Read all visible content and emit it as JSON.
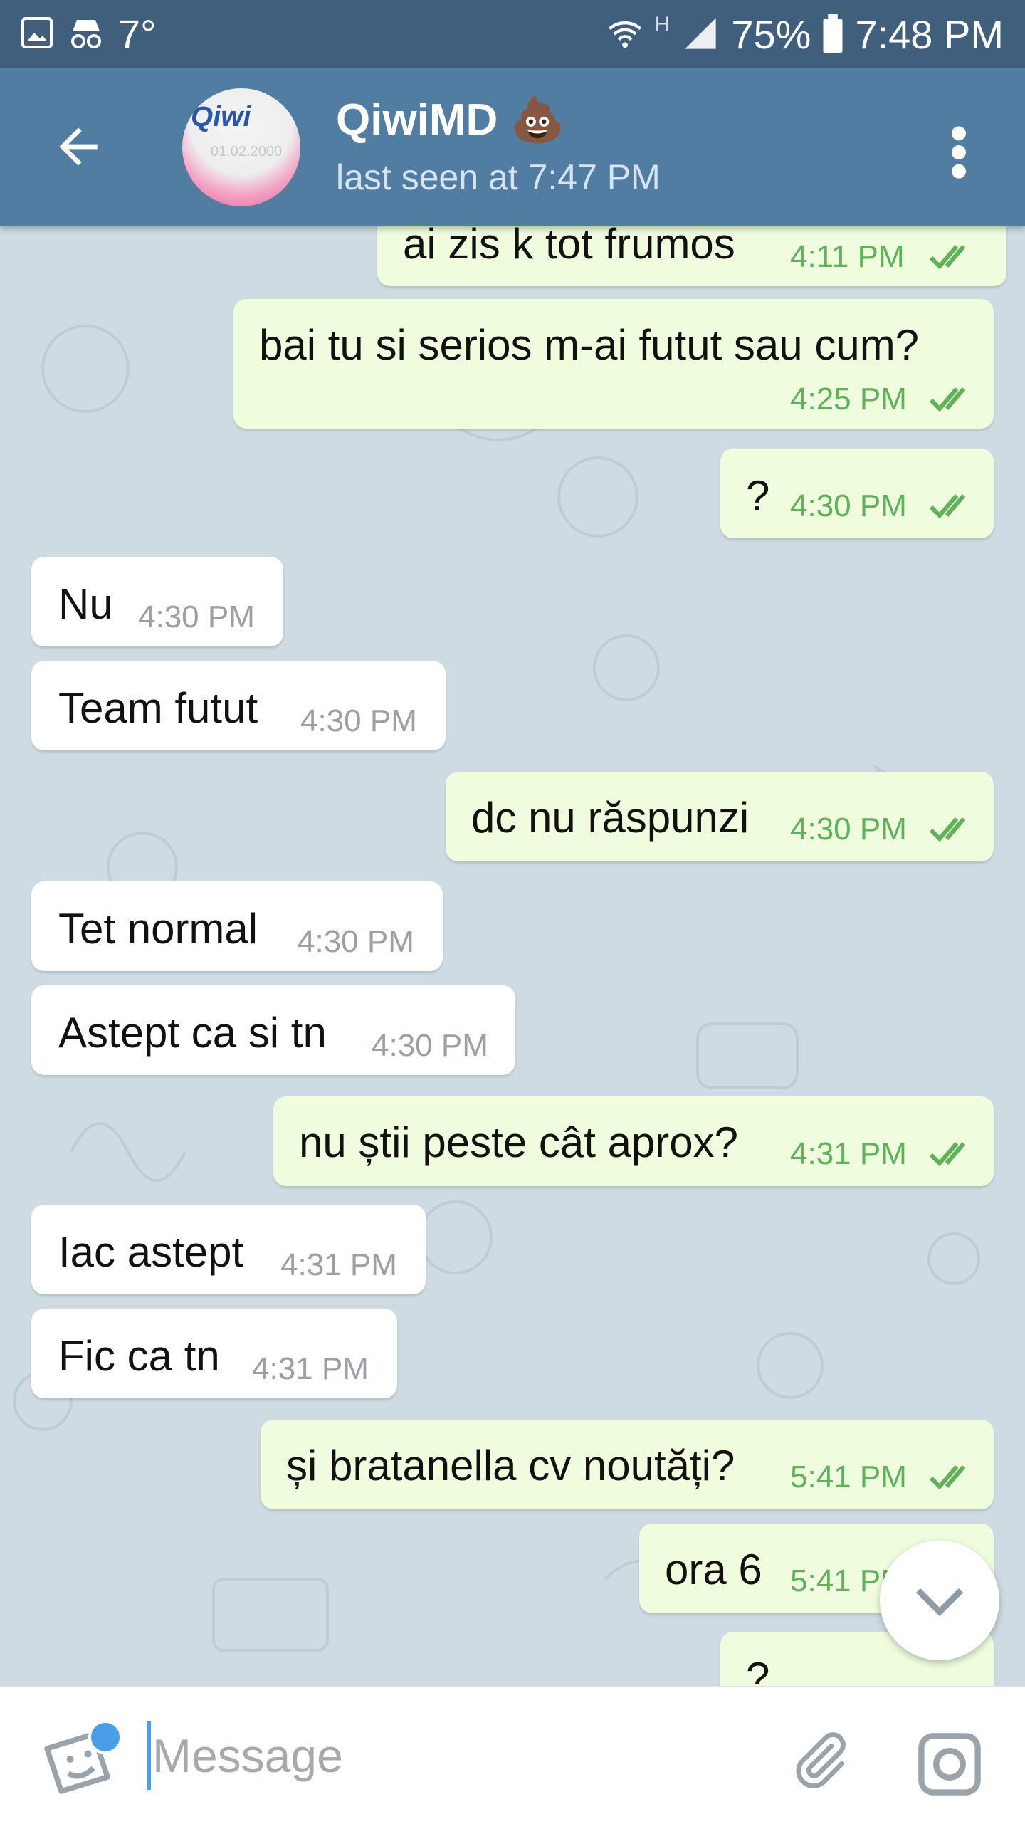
{
  "status_bar": {
    "temperature": "7°",
    "network_type": "H",
    "battery": "75%",
    "time": "7:48 PM"
  },
  "header": {
    "contact_name": "QiwiMD 💩",
    "last_seen": "last seen at 7:47 PM",
    "avatar_logo": "Qiwi",
    "avatar_date": "01.02.2000"
  },
  "messages": [
    {
      "dir": "out",
      "text": "ai zis k tot frumos",
      "time": "4:11 PM"
    },
    {
      "dir": "out",
      "text": "bai tu si serios m-ai futut sau cum?",
      "time": "4:25 PM"
    },
    {
      "dir": "out",
      "text": "?",
      "time": "4:30 PM"
    },
    {
      "dir": "in",
      "text": "Nu",
      "time": "4:30 PM"
    },
    {
      "dir": "in",
      "text": "Team futut",
      "time": "4:30 PM"
    },
    {
      "dir": "out",
      "text": "dc nu răspunzi",
      "time": "4:30 PM"
    },
    {
      "dir": "in",
      "text": "Tet normal",
      "time": "4:30 PM"
    },
    {
      "dir": "in",
      "text": "Astept ca si tn",
      "time": "4:30 PM"
    },
    {
      "dir": "out",
      "text": "nu știi peste cât aprox?",
      "time": "4:31 PM"
    },
    {
      "dir": "in",
      "text": "Iac astept",
      "time": "4:31 PM"
    },
    {
      "dir": "in",
      "text": "Fic ca tn",
      "time": "4:31 PM"
    },
    {
      "dir": "out",
      "text": "și bratanella cv noutăți?",
      "time": "5:41 PM"
    },
    {
      "dir": "out",
      "text": "ora 6",
      "time": "5:41 PM"
    },
    {
      "dir": "out",
      "text": "?",
      "time": "",
      "partial": true
    }
  ],
  "input": {
    "placeholder": "Message"
  },
  "colors": {
    "status_bar": "#3f5f7d",
    "app_bar": "#527da3",
    "outgoing_bubble": "#effdde",
    "incoming_bubble": "#ffffff",
    "outgoing_time": "#5fb15a",
    "accent": "#4a9ee8"
  },
  "icons": [
    "image-icon",
    "incognito-icon",
    "wifi-icon",
    "signal-icon",
    "battery-icon",
    "back-arrow-icon",
    "more-vert-icon",
    "double-check-icon",
    "chevron-down-icon",
    "sticker-icon",
    "paperclip-icon",
    "camera-icon"
  ]
}
